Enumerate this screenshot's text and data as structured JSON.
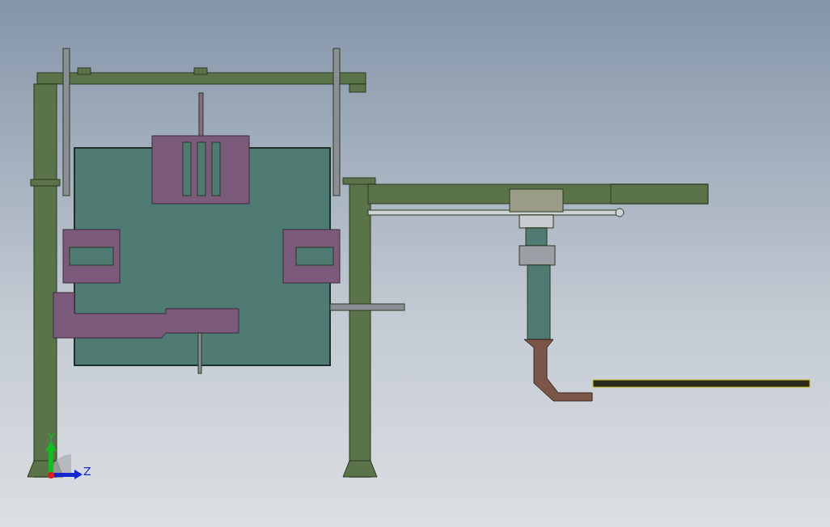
{
  "triad": {
    "axes": [
      {
        "label": "Y",
        "color": "#10c020"
      },
      {
        "label": "Z",
        "color": "#1428d0"
      }
    ]
  }
}
